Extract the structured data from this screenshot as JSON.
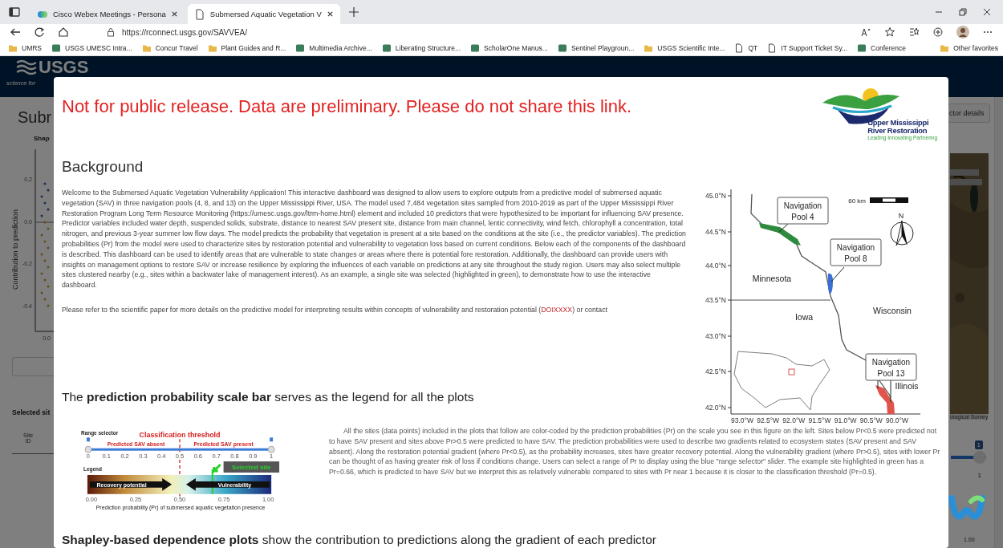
{
  "browser": {
    "tabs": [
      {
        "title": "Cisco Webex Meetings - Persona",
        "kind": "app",
        "selected": false
      },
      {
        "title": "Submersed Aquatic Vegetation V",
        "kind": "page",
        "selected": true
      }
    ],
    "address": "https://rconnect.usgs.gov/SAVVEA/",
    "bookmarks": [
      {
        "label": "UMRS",
        "kind": "folder"
      },
      {
        "label": "USGS UMESC Intra...",
        "kind": "app"
      },
      {
        "label": "Concur Travel",
        "kind": "folder"
      },
      {
        "label": "Plant Guides and R...",
        "kind": "folder"
      },
      {
        "label": "Multimedia Archive...",
        "kind": "app"
      },
      {
        "label": "Liberating Structure...",
        "kind": "app"
      },
      {
        "label": "ScholarOne Manus...",
        "kind": "app"
      },
      {
        "label": "Sentinel Playgroun...",
        "kind": "app"
      },
      {
        "label": "USGS Scientific Inte...",
        "kind": "folder"
      },
      {
        "label": "QT",
        "kind": "page"
      },
      {
        "label": "IT Support Ticket Sy...",
        "kind": "page"
      },
      {
        "label": "Conference",
        "kind": "app"
      }
    ],
    "other_favorites": "Other favorites"
  },
  "dashboard": {
    "logo": "USGS",
    "logo_tagline": "science for",
    "title": "Subr",
    "plot_title": "Shap",
    "y_label": "Contribution to prediction",
    "y_ticks": [
      "0.2",
      "0.0",
      "-0.2",
      "-0.4"
    ],
    "x_tick": "0.0",
    "section": "Selected sit",
    "column": "Site ID",
    "button": "ctor details",
    "map_credit": "ological Survey",
    "slider_badge": "1",
    "slider": {
      "level": 1
    },
    "slider_value": "1",
    "scale_value": "1.00"
  },
  "modal": {
    "notice": "Not for public release. Data are preliminary. Please do not share this link.",
    "logo": {
      "line_1": "Upper Mississippi",
      "line_2": "River Restoration",
      "tagline": "Leading Innovating Partnering"
    },
    "heading": "Background",
    "paragraph": "Welcome to the Submersed Aquatic Vegetation Vulnerability Application! This interactive dashboard was designed to allow users to explore outputs from a predictive model of submersed aquatic vegetation (SAV) in three navigation pools (4, 8, and 13) on the Upper Mississippi River, USA. The model used 7,484 vegetation sites sampled from 2010-2019 as part of the Upper Mississippi River Restoration Program Long Term Resource Monitoring (https://umesc.usgs.gov/ltrm-home.html) element and included 10 predictors that were hypothesized to be important for influencing SAV presence. Predictor variables included water depth, suspended solids, substrate, distance to nearest SAV present site, distance from main channel, lentic connectivity, wind fetch, chlorophyll a concentration, total nitrogen, and previous 3-year summer low flow days. The model predicts the probability that vegetation is present at a site based on the conditions at the site (i.e., the predictor variables). The prediction probabilities (Pr) from the model were used to characterize sites by restoration potential and vulnerability to vegetation loss based on current conditions. Below each of the components of the dashboard is described. This dashboard can be used to identify areas that are vulnerable to state changes or areas where there is potential fore restoration. Additionally, the dashboard can provide users with insights on management options to restore SAV or increase resilience by exploring the influences of each variable on predictions at any site throughout the study region. Users may also select multiple sites clustered nearby (e.g., sites within a backwater lake of management interest). As an example, a single site was selected (highlighted in green), to demonstrate how to use the interactive dashboard.",
    "refer_start": "Please refer to the scientific paper for more details on the predictive model for interpreting results within concepts of vulnerability and restoration potential (",
    "refer_link": "DOIXXXX",
    "refer_end": ") or contact",
    "map": {
      "lat_ticks": [
        "45.0°N",
        "44.5°N",
        "44.0°N",
        "43.5°N",
        "43.0°N",
        "42.5°N",
        "42.0°N"
      ],
      "lon_ticks": [
        "93.0°W",
        "92.5°W",
        "92.0°W",
        "91.5°W",
        "91.0°W",
        "90.5°W",
        "90.0°W"
      ],
      "pools": [
        {
          "line_1": "Navigation",
          "line_2": "Pool 4",
          "color": "#2e8b3e"
        },
        {
          "line_1": "Navigation",
          "line_2": "Pool 8",
          "color": "#3b6fd4"
        },
        {
          "line_1": "Navigation",
          "line_2": "Pool 13",
          "color": "#e0544c"
        }
      ],
      "states": [
        "Minnesota",
        "Iowa",
        "Wisconsin",
        "Illinois"
      ],
      "scale_label": "60 km",
      "north": "N"
    },
    "scale_heading": "The **prediction probability scale bar** serves as the legend for all the plots",
    "scale_figure": {
      "range_label": "Range selector",
      "threshold": "Classification threshold",
      "absent": "Predicted SAV absent",
      "present": "Predicted SAV present",
      "slider_ticks": [
        "0",
        "0.1",
        "0.2",
        "0.3",
        "0.4",
        "0.5",
        "0.6",
        "0.7",
        "0.8",
        "0.9",
        "1"
      ],
      "legend": "Legend",
      "selected": "Selected site",
      "recovery": "Recovery potential",
      "vulnerability": "Vulnerability",
      "axis_ticks": [
        "0.00",
        "0.25",
        "0.50",
        "0.75",
        "1.00"
      ],
      "caption": "Prediction probability (Pr) of submersed aquatic vegetation presence"
    },
    "scale_text": "All the sites (data points) included in the plots that follow are color-coded by the prediction probabilities (Pr) on the scale you see in this figure on the left. Sites below Pr<0.5 were predicted not to have SAV present and sites above Pr>0.5 were predicted to have SAV. The prediction probabilities were used to describe two gradients related to ecosystem states (SAV present and SAV absent). Along the restoration potential gradient (where Pr<0.5), as the probability increases, sites have greater recovery potential. Along the vulnerability gradient (where Pr>0.5), sites with lower Pr can be thought of as having greater risk of loss if conditions change. Users can select a range of Pr to display using the blue \"range selector\" slider. The example site highlighted in green has a Pr=0.66, which is predicted to have SAV but we interpret this as relatively vulnerable compared to sites with Pr near 1 because it is closer to the classification threshold (Pr=0.5).",
    "next_heading": "**Shapley-based dependence plots** show the contribution to predictions along the gradient of each predictor"
  }
}
